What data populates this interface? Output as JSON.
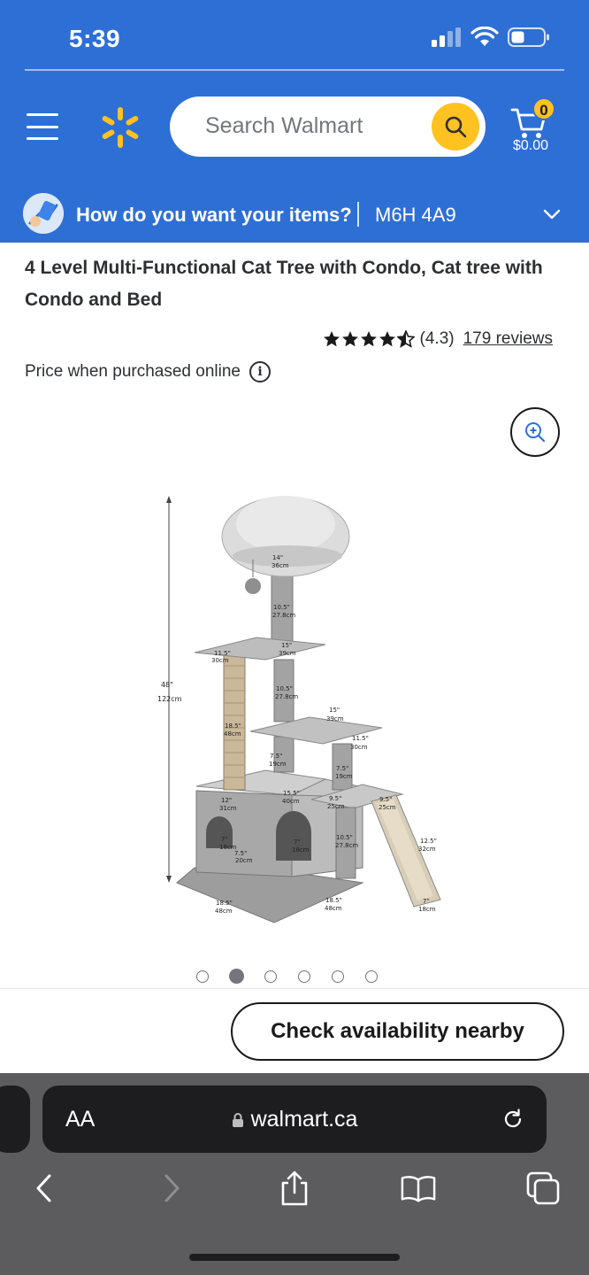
{
  "status": {
    "time": "5:39"
  },
  "header": {
    "search_placeholder": "Search Walmart",
    "cart": {
      "count": "0",
      "total": "$0.00"
    },
    "brand_blue": "#2e6fd6",
    "accent_yellow": "#ffc220"
  },
  "delivery": {
    "question": "How do you want your items?",
    "postal_code": "M6H 4A9"
  },
  "product": {
    "title": "4 Level Multi-Functional Cat Tree with Condo, Cat tree with Condo and Bed",
    "rating": {
      "stars": 4.3,
      "value_text": "(4.3)",
      "reviews_text": "179 reviews"
    },
    "price_note": "Price when purchased online",
    "image": {
      "total_images": 6,
      "active_index": 1,
      "dimensions": {
        "height": "48\"",
        "height_cm": "122cm",
        "bed_width": "14\"",
        "bed_width_cm": "36cm",
        "post1": "10.5\"",
        "post1_cm": "27.8cm",
        "shelf_left": "11.5\"",
        "shelf_left_cm": "30cm",
        "shelf_mid": "15\"",
        "shelf_mid_cm": "39cm",
        "post2": "10.5\"",
        "post2_cm": "27.8cm",
        "shelf_right": "15\"",
        "shelf_right_cm": "39cm",
        "post_tall": "18.5\"",
        "post_tall_cm": "48cm",
        "post_small": "11.5\"",
        "post_small_cm": "30cm",
        "gap1": "7.5\"",
        "gap1_cm": "19cm",
        "gap2": "7.5\"",
        "gap2_cm": "19cm",
        "condo_w": "12\"",
        "condo_w_cm": "31cm",
        "condo_top": "15.5\"",
        "condo_top_cm": "40cm",
        "step1": "9.5\"",
        "step1_cm": "25cm",
        "step2": "9.5\"",
        "step2_cm": "25cm",
        "hole1": "7\"",
        "hole1_cm": "18cm",
        "hole1b": "7.5\"",
        "hole1b_cm": "20cm",
        "hole2": "7\"",
        "hole2_cm": "18cm",
        "post3": "10.5\"",
        "post3_cm": "27.8cm",
        "ramp": "12.5\"",
        "ramp_cm": "32cm",
        "ramp_w": "7\"",
        "ramp_w_cm": "18cm",
        "base1": "18.5\"",
        "base1_cm": "48cm",
        "base2": "18.5\"",
        "base2_cm": "48cm"
      }
    },
    "check_button": "Check availability nearby"
  },
  "browser": {
    "aa_label": "AA",
    "domain": "walmart.ca"
  }
}
